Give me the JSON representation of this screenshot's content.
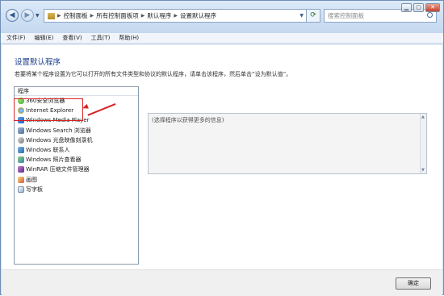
{
  "address": {
    "crumbs": [
      "控制面板",
      "所有控制面板项",
      "默认程序",
      "设置默认程序"
    ]
  },
  "search": {
    "placeholder": "搜索控制面板"
  },
  "window_controls": {
    "minimize": "▁",
    "maximize": "▢",
    "close": "✕"
  },
  "menu": [
    "文件(F)",
    "编辑(E)",
    "查看(V)",
    "工具(T)",
    "帮助(H)"
  ],
  "page": {
    "title": "设置默认程序",
    "description": "若要将某个程序设置为它可以打开的所有文件类型和协议的默认程序，请单击该程序，然后单击“设为默认值”。"
  },
  "program_list": {
    "header": "程序",
    "items": [
      {
        "label": "360安全浏览器",
        "icon": "browser-360-icon"
      },
      {
        "label": "Internet Explorer",
        "icon": "internet-explorer-icon"
      },
      {
        "label": "Windows Media Player",
        "icon": "media-player-icon"
      },
      {
        "label": "Windows Search 浏览器",
        "icon": "windows-search-icon"
      },
      {
        "label": "Windows 光盘映像刻录机",
        "icon": "disc-burner-icon"
      },
      {
        "label": "Windows 联系人",
        "icon": "contacts-icon"
      },
      {
        "label": "Windows 照片查看器",
        "icon": "photo-viewer-icon"
      },
      {
        "label": "WinRAR 压缩文件管理器",
        "icon": "winrar-icon"
      },
      {
        "label": "画图",
        "icon": "paint-icon"
      },
      {
        "label": "写字板",
        "icon": "wordpad-icon"
      }
    ]
  },
  "info_box": {
    "text": "(选择程序以获得更多的信息)"
  },
  "footer": {
    "ok_label": "确定"
  },
  "colors": {
    "title": "#1c3d8b",
    "highlight": "#d92121",
    "chrome": "#cfe0f3"
  }
}
